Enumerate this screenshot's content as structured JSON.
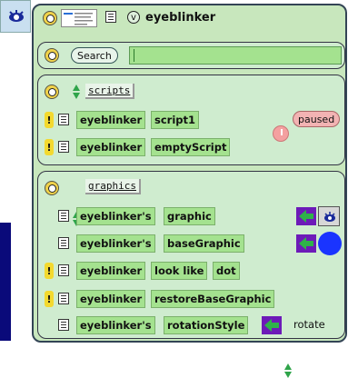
{
  "header": {
    "object_name": "eyeblinker",
    "v_label": "v"
  },
  "search": {
    "button_label": "Search",
    "value": ""
  },
  "scripts": {
    "category_label": "scripts",
    "rows": [
      {
        "object": "eyeblinker",
        "item": "script1",
        "status": "paused"
      },
      {
        "object": "eyeblinker",
        "item": "emptyScript"
      }
    ]
  },
  "graphics": {
    "category_label": "graphics",
    "rows": [
      {
        "object": "eyeblinker's",
        "item": "graphic"
      },
      {
        "object": "eyeblinker's",
        "item": "baseGraphic"
      },
      {
        "object": "eyeblinker",
        "item": "look like",
        "arg": "dot"
      },
      {
        "object": "eyeblinker",
        "item": "restoreBaseGraphic"
      },
      {
        "object": "eyeblinker's",
        "item": "rotationStyle",
        "value": "rotate"
      }
    ]
  },
  "colors": {
    "viewer_bg": "#c8e7bd",
    "tile_bg": "#a4e28f",
    "arrow_green": "#2fb24a",
    "arrow_bg_purple": "#6d1ab8",
    "paused_bg": "#f2b3b3",
    "blue_dot": "#1a34ff"
  },
  "icons": [
    "eye-icon",
    "menu-icon",
    "up-down-arrows-icon",
    "green-left-arrow-icon",
    "clock-icon",
    "exclamation-icon"
  ]
}
